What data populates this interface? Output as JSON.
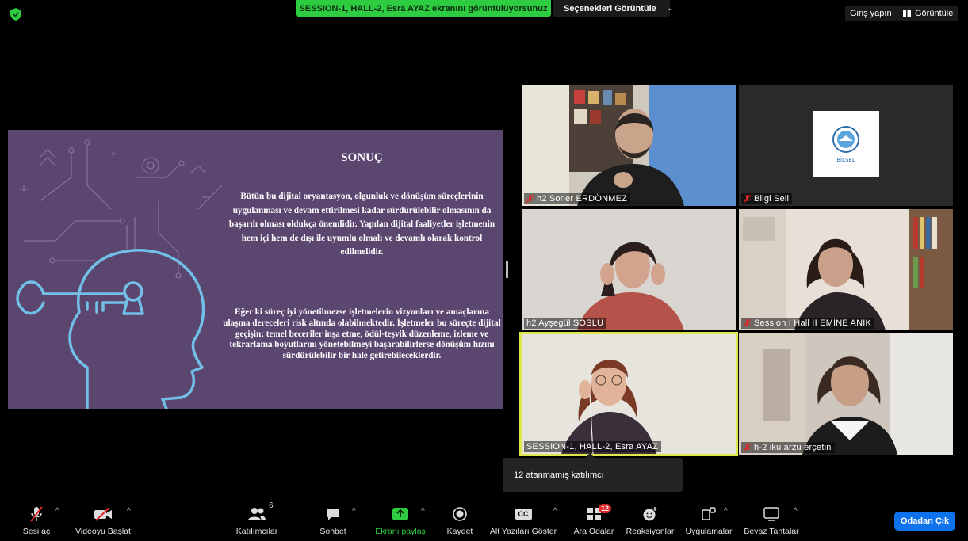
{
  "top_bar": {
    "share_banner": "SESSION-1, HALL-2, Esra AYAZ ekranını görüntülüyorsunuz",
    "view_options": "Seçenekleri Görüntüle",
    "login": "Giriş yapın",
    "view": "Görüntüle"
  },
  "slide": {
    "title": "SONUÇ",
    "paragraph1": "Bütün bu dijital oryantasyon, olgunluk ve dönüşüm süreçlerinin uygulanması ve devam ettirilmesi kadar sürdürülebilir olmasının da başarılı olması oldukça önemlidir. Yapılan dijital faaliyetler işletmenin hem içi hem de dışı ile uyumlu olmalı ve devamlı olarak kontrol edilmelidir.",
    "paragraph2": "Eğer ki süreç iyi yönetilmezse işletmelerin vizyonları ve amaçlarına ulaşma dereceleri risk altında olabilmektedir. İşletmeler bu süreçte dijital geçişin; temel beceriler inşa etme, ödül-teşvik düzenleme, izleme ve tekrarlama boyutlarını yönetebilmeyi başarabilirlerse dönüşüm hızını sürdürülebilir bir hale getirebileceklerdir."
  },
  "participants": [
    {
      "name": "h2 Soner ERDÖNMEZ",
      "muted": true
    },
    {
      "name": "Bilgi Seli",
      "muted": true
    },
    {
      "name": "h2 Ayşegül SOSLU",
      "muted": false
    },
    {
      "name": "Session I Hall II EMİNE ANIK",
      "muted": true
    },
    {
      "name": "SESSION-1, HALL-2, Esra AYAZ",
      "muted": false,
      "active_speaker": true
    },
    {
      "name": "h-2 iku arzu erçetin",
      "muted": true
    }
  ],
  "bilgi_logo_text": "BİLSEL",
  "unassigned_popup": "12 atanmamış katılımcı",
  "toolbar": {
    "audio": "Sesi aç",
    "video": "Videoyu Başlat",
    "participants": "Katılımcılar",
    "participants_count": "6",
    "chat": "Sohbet",
    "share": "Ekranı paylaş",
    "record": "Kaydet",
    "captions": "Alt Yazıları Göster",
    "captions_icon": "CC",
    "breakout": "Ara Odalar",
    "breakout_count": "12",
    "reactions": "Reaksiyonlar",
    "apps": "Uygulamalar",
    "whiteboard": "Beyaz Tahtalar",
    "leave": "Odadan Çık"
  },
  "colors": {
    "banner_green": "#2ecc40",
    "active_speaker_border": "#dfe84a",
    "leave_blue": "#0e72ed",
    "slide_bg": "#5b4670",
    "muted_red": "#e02828"
  }
}
